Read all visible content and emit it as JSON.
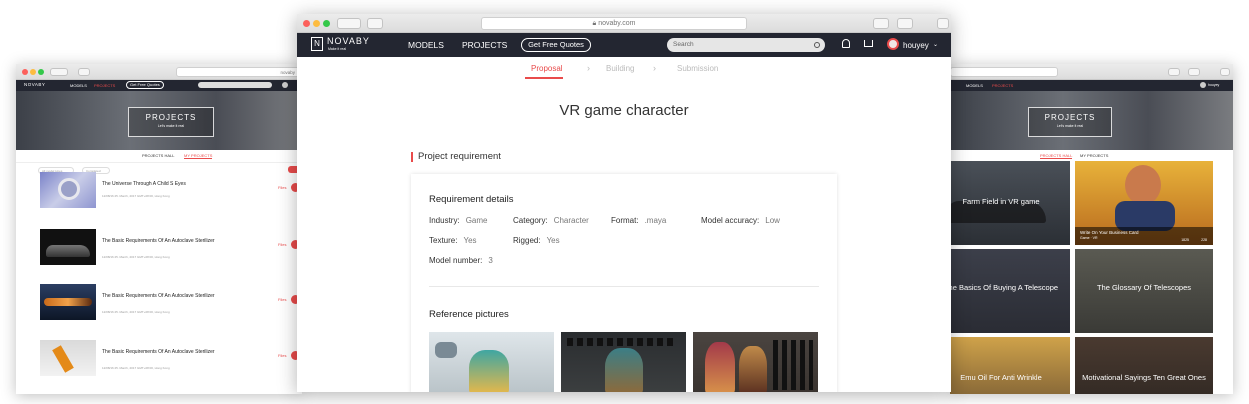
{
  "center": {
    "url": "novaby.com",
    "brand": "NOVABY",
    "brand_tagline": "Make it real",
    "nav": {
      "models": "MODELS",
      "projects": "PROJECTS",
      "quote_button": "Get Free Quotes",
      "search_placeholder": "Search",
      "username": "houyey"
    },
    "steps": [
      {
        "label": "Proposal",
        "active": true
      },
      {
        "label": "Building",
        "active": false
      },
      {
        "label": "Submission",
        "active": false
      }
    ],
    "page_title": "VR game character",
    "section_title": "Project requirement",
    "details": {
      "heading": "Requirement details",
      "industry_label": "Industry:",
      "industry": "Game",
      "category_label": "Category:",
      "category": "Character",
      "format_label": "Format:",
      "format": ".maya",
      "accuracy_label": "Model accuracy:",
      "accuracy": "Low",
      "texture_label": "Texture:",
      "texture": "Yes",
      "rigged_label": "Rigged:",
      "rigged": "Yes",
      "number_label": "Model number:",
      "number": "3"
    },
    "reference_heading": "Reference pictures"
  },
  "left": {
    "url": "novaby",
    "brand": "NOVABY",
    "nav": {
      "models": "MODELS",
      "projects": "PROJECTS",
      "quote_button": "Get Free Quotes"
    },
    "hero_title": "PROJECTS",
    "hero_sub": "Let's make it real",
    "tabs": [
      "PROJECTS HALL",
      "MY PROJECTS"
    ],
    "filters": [
      "All model types",
      "Completed"
    ],
    "items": [
      {
        "title": "The Universe Through A Child S Eyes",
        "meta": "12/08/16  25. March, 2017 GMT+08:00, Hong Kong",
        "file": "Files"
      },
      {
        "title": "The Basic Requirements Of An Autoclave Sterilizer",
        "meta": "12/08/16  25. March, 2017 GMT+08:00, Hong Kong",
        "file": "Files"
      },
      {
        "title": "The Basic Requirements Of An Autoclave Sterilizer",
        "meta": "12/08/16  25. March, 2017 GMT+08:00, Hong Kong",
        "file": "Files"
      },
      {
        "title": "The Basic Requirements Of An Autoclave Sterilizer",
        "meta": "12/08/16  25. March, 2017 GMT+08:00, Hong Kong",
        "file": "Files"
      }
    ]
  },
  "right": {
    "nav": {
      "models": "MODELS",
      "projects": "PROJECTS",
      "username": "houyey"
    },
    "hero_title": "PROJECTS",
    "hero_sub": "Let's make it real",
    "tabs": [
      "PROJECTS HALL",
      "MY PROJECTS"
    ],
    "cards": [
      {
        "title": "Farm Field in VR game"
      },
      {
        "title": "Write On Your Business Card",
        "tags": "Game · VR",
        "views": "1825",
        "likes": "228"
      },
      {
        "title": "The Basics Of Buying A Telescope"
      },
      {
        "title": "The Glossary Of Telescopes"
      },
      {
        "title": "Emu Oil For Anti Wrinkle"
      },
      {
        "title": "Motivational Sayings Ten Great Ones"
      }
    ]
  },
  "colors": {
    "accent": "#e94b4b",
    "nav_bg": "#232631"
  }
}
